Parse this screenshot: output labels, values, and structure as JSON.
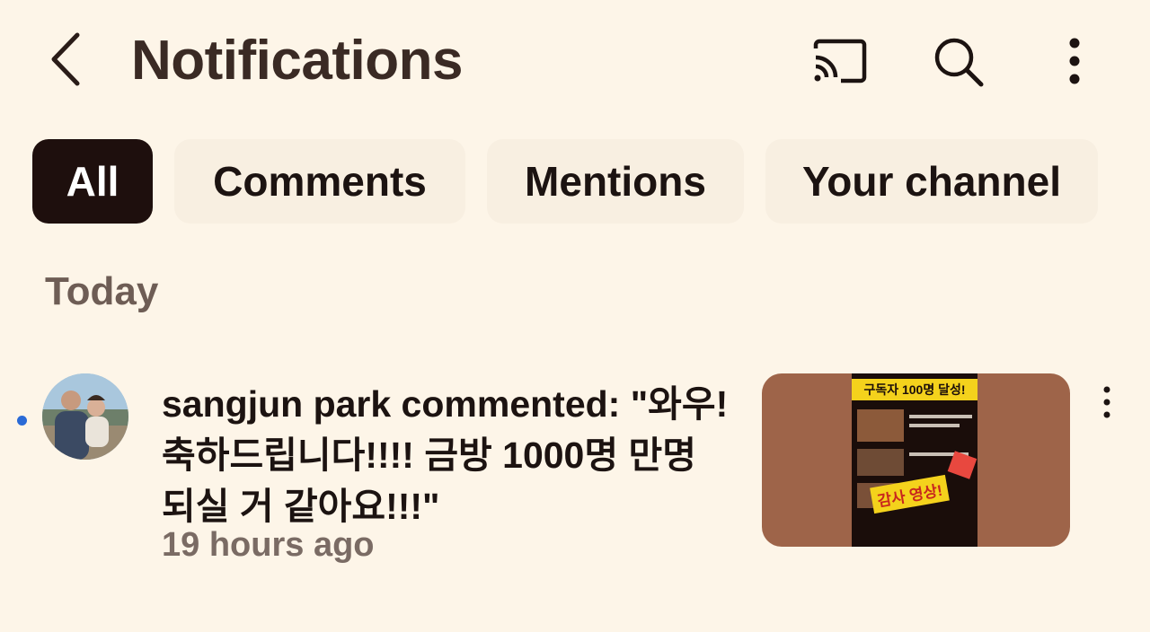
{
  "header": {
    "title": "Notifications",
    "back_icon": "chevron-left-icon",
    "cast_icon": "cast-icon",
    "search_icon": "search-icon",
    "more_icon": "more-vertical-icon"
  },
  "filters": {
    "chips": [
      {
        "label": "All",
        "selected": true
      },
      {
        "label": "Comments",
        "selected": false
      },
      {
        "label": "Mentions",
        "selected": false
      },
      {
        "label": "Your channel",
        "selected": false
      }
    ]
  },
  "sections": [
    {
      "title": "Today",
      "notifications": [
        {
          "unread": true,
          "text": "sangjun park commented: \"와우! 축하드립니다!!!! 금방 1000명 만명 되실 거 같아요!!!\"",
          "time": "19 hours ago",
          "thumbnail": {
            "banner": "구독자 100명 달성!",
            "sticker": "감사 영상!"
          }
        }
      ]
    }
  ],
  "colors": {
    "background": "#fdf5e8",
    "chip_active_bg": "#1e0f0d",
    "chip_bg": "#f8efe1",
    "unread_dot": "#2a6ad6",
    "text_primary": "#1c1311",
    "text_secondary": "#7a6b64"
  }
}
